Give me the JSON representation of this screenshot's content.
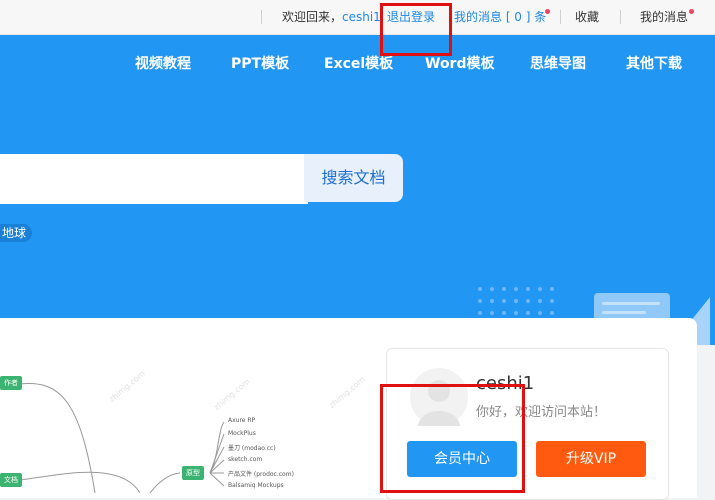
{
  "topbar": {
    "welcome_prefix": "欢迎回来，",
    "username": "ceshi1",
    "logout": "退出登录",
    "messages": "我的消息 [ 0 ] 条",
    "favorites": "收藏",
    "my_messages": "我的消息"
  },
  "nav": {
    "items": [
      "视频教程",
      "PPT模板",
      "Excel模板",
      "Word模板",
      "思维导图",
      "其他下载"
    ]
  },
  "search": {
    "placeholder": "",
    "button_label": "搜索文档"
  },
  "hot_tag": "地球",
  "user_card": {
    "username": "ceshi1",
    "greeting": "你好，欢迎访问本站！",
    "member_button": "会员中心",
    "vip_button": "升级VIP"
  },
  "mindmap": {
    "nodes": [
      "作者",
      "原型",
      "文档"
    ],
    "leaves": [
      "Axure RP",
      "MockPlus",
      "墨刀 (modao.cc)",
      "sketch.com",
      "产品文件 (prodoc.com)",
      "Balsamiq Mockups"
    ],
    "watermark": "zhimg.com"
  },
  "colors": {
    "brand_blue": "#2196f3",
    "vip_orange": "#ff5a0f",
    "highlight_red": "#e01010"
  }
}
